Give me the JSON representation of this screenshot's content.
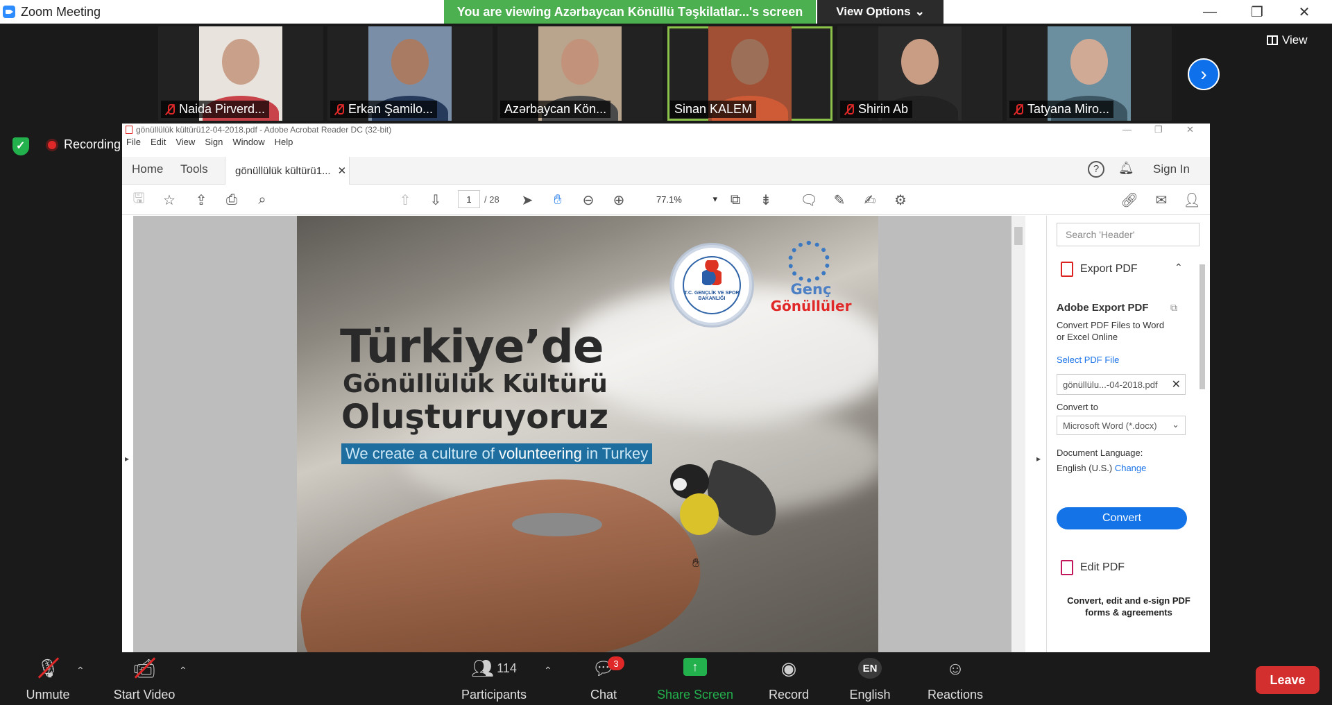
{
  "window": {
    "title": "Zoom Meeting"
  },
  "banner": {
    "viewing_text": "You are viewing Azərbaycan Könüllü Təşkilatlar...'s screen",
    "view_options": "View Options"
  },
  "gallery": {
    "participants": [
      {
        "name": "Naida Pirverd...",
        "muted": true,
        "face_color": "#c9a08a",
        "shirt": "#c9444a",
        "bg": "#e8e3dc"
      },
      {
        "name": "Erkan Şamilo...",
        "muted": true,
        "face_color": "#a87b62",
        "shirt": "#263a5c",
        "bg": "#7a8ea8"
      },
      {
        "name": "Azərbaycan Kön...",
        "muted": false,
        "face_color": "#c2927a",
        "shirt": "#4a4a4a",
        "bg": "#b9a58e"
      },
      {
        "name": "Sinan KALEM",
        "muted": false,
        "active": true,
        "face_color": "#9c6f58",
        "shirt": "#cf5a36",
        "bg": "#a15036"
      },
      {
        "name": "Shirin Ab",
        "muted": true,
        "face_color": "#c99c84",
        "shirt": "#222222",
        "bg": "#2b2b2b"
      },
      {
        "name": "Tatyana Miro...",
        "muted": true,
        "face_color": "#d1aa95",
        "shirt": "#3c5663",
        "bg": "#6c8fa0"
      }
    ],
    "view_label": "View"
  },
  "recording": {
    "label": "Recording"
  },
  "acrobat": {
    "title": "gönüllülük kültürü12-04-2018.pdf - Adobe Acrobat Reader DC (32-bit)",
    "menu": [
      "File",
      "Edit",
      "View",
      "Sign",
      "Window",
      "Help"
    ],
    "tabs": {
      "home": "Home",
      "tools": "Tools",
      "doc": "gönüllülük kültürü1..."
    },
    "sign_in": "Sign In",
    "page_current": "1",
    "page_total": "/ 28",
    "zoom": "77.1%",
    "document": {
      "title_line1": "Türkiye’de",
      "title_line2": "Gönüllülük Kültürü",
      "title_line3": "Oluşturuyoruz",
      "subtitle_pre": "We create a culture of",
      "subtitle_bold": "volunteering",
      "subtitle_post": "in Turkey",
      "seal_text": "T.C. GENÇLİK VE SPOR BAKANLIĞI",
      "logo_line1": "Genç",
      "logo_line2": "Gönüllüler"
    },
    "panel": {
      "search_placeholder": "Search 'Header'",
      "export_header": "Export PDF",
      "export_title": "Adobe Export PDF",
      "export_desc1": "Convert PDF Files to Word",
      "export_desc2": "or Excel Online",
      "select_file": "Select PDF File",
      "file_name": "gönüllülu...-04-2018.pdf",
      "convert_to": "Convert to",
      "format": "Microsoft Word (*.docx)",
      "doc_language": "Document Language:",
      "language": "English (U.S.)",
      "change": "Change",
      "convert_btn": "Convert",
      "edit_pdf": "Edit PDF",
      "footer1": "Convert, edit and e-sign PDF",
      "footer2": "forms & agreements"
    }
  },
  "bottombar": {
    "unmute": "Unmute",
    "start_video": "Start Video",
    "participants": "Participants",
    "participant_count": "114",
    "chat": "Chat",
    "chat_badge": "3",
    "share_screen": "Share Screen",
    "record": "Record",
    "language": "English",
    "language_code": "EN",
    "reactions": "Reactions",
    "leave": "Leave"
  }
}
